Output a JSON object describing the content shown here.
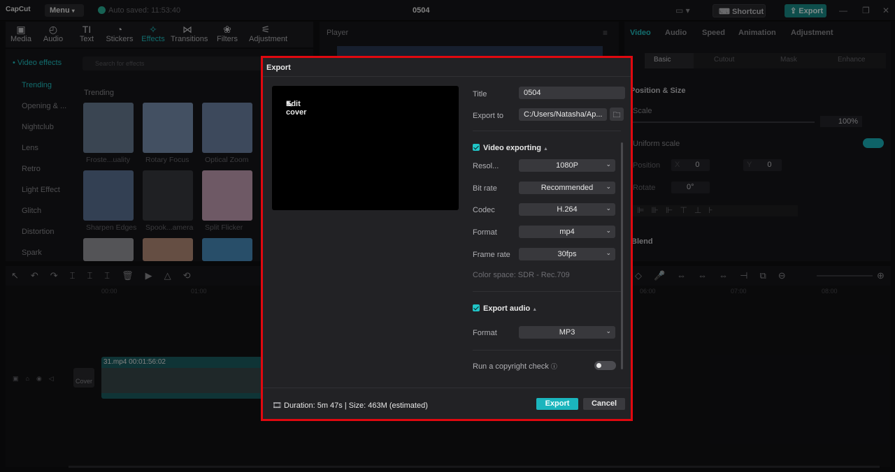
{
  "app": {
    "logo": "CapCut",
    "menu": "Menu",
    "autosave": "Auto saved: 11:53:40",
    "project_title": "0504",
    "shortcut": "Shortcut",
    "export": "Export"
  },
  "media_tools": [
    {
      "icon": "media-icon",
      "glyph": "▣",
      "label": "Media"
    },
    {
      "icon": "audio-icon",
      "glyph": "◴",
      "label": "Audio"
    },
    {
      "icon": "text-icon",
      "glyph": "TI",
      "label": "Text"
    },
    {
      "icon": "stickers-icon",
      "glyph": "◔",
      "label": "Stickers"
    },
    {
      "icon": "effects-icon",
      "glyph": "✧",
      "label": "Effects"
    },
    {
      "icon": "transitions-icon",
      "glyph": "⋈",
      "label": "Transitions"
    },
    {
      "icon": "filters-icon",
      "glyph": "❀",
      "label": "Filters"
    },
    {
      "icon": "adjustment-icon",
      "glyph": "⚟",
      "label": "Adjustment"
    }
  ],
  "effects_panel": {
    "category": "• Video effects",
    "search_placeholder": "Search for effects",
    "items": [
      "Trending",
      "Opening & ...",
      "Nightclub",
      "Lens",
      "Retro",
      "Light Effect",
      "Glitch",
      "Distortion",
      "Spark"
    ],
    "section": "Trending",
    "thumbs": [
      "Froste...uality",
      "Rotary Focus",
      "Optical Zoom",
      "Sharpen Edges",
      "Spook...amera",
      "Split Flicker"
    ]
  },
  "player": {
    "title": "Player"
  },
  "right_panel": {
    "tabs": [
      "Video",
      "Audio",
      "Speed",
      "Animation",
      "Adjustment"
    ],
    "subtabs": [
      "Basic",
      "Cutout",
      "Mask",
      "Enhance"
    ],
    "position_size": "Position & Size",
    "scale": "Scale",
    "scale_value": "100%",
    "uniform_scale": "Uniform scale",
    "position": "Position",
    "x": "X",
    "x_value": "0",
    "y": "Y",
    "y_value": "0",
    "rotate": "Rotate",
    "rotate_value": "0°",
    "blend": "Blend"
  },
  "timeline": {
    "ticks": [
      "00:00",
      "01:00",
      "06:00",
      "07:00",
      "08:00"
    ],
    "clip_label": "31.mp4  00:01:56:02",
    "cover": "Cover"
  },
  "export_dialog": {
    "title": "Export",
    "edit_cover": "Edit cover",
    "title_label": "Title",
    "title_value": "0504",
    "export_to_label": "Export to",
    "export_to_value": "C:/Users/Natasha/Ap...",
    "video_exporting": "Video exporting",
    "resolution_label": "Resol...",
    "resolution_value": "1080P",
    "bitrate_label": "Bit rate",
    "bitrate_value": "Recommended",
    "codec_label": "Codec",
    "codec_value": "H.264",
    "format_label": "Format",
    "format_value": "mp4",
    "framerate_label": "Frame rate",
    "framerate_value": "30fps",
    "color_space": "Color space: SDR - Rec.709",
    "export_audio": "Export audio",
    "audio_format_label": "Format",
    "audio_format_value": "MP3",
    "copyright_check": "Run a copyright check",
    "duration_size": "Duration: 5m 47s | Size: 463M (estimated)",
    "export_button": "Export",
    "cancel_button": "Cancel"
  },
  "colors": {
    "accent": "#21c5c7",
    "highlight_border": "#e0080f",
    "dialog_bg": "#222225"
  }
}
